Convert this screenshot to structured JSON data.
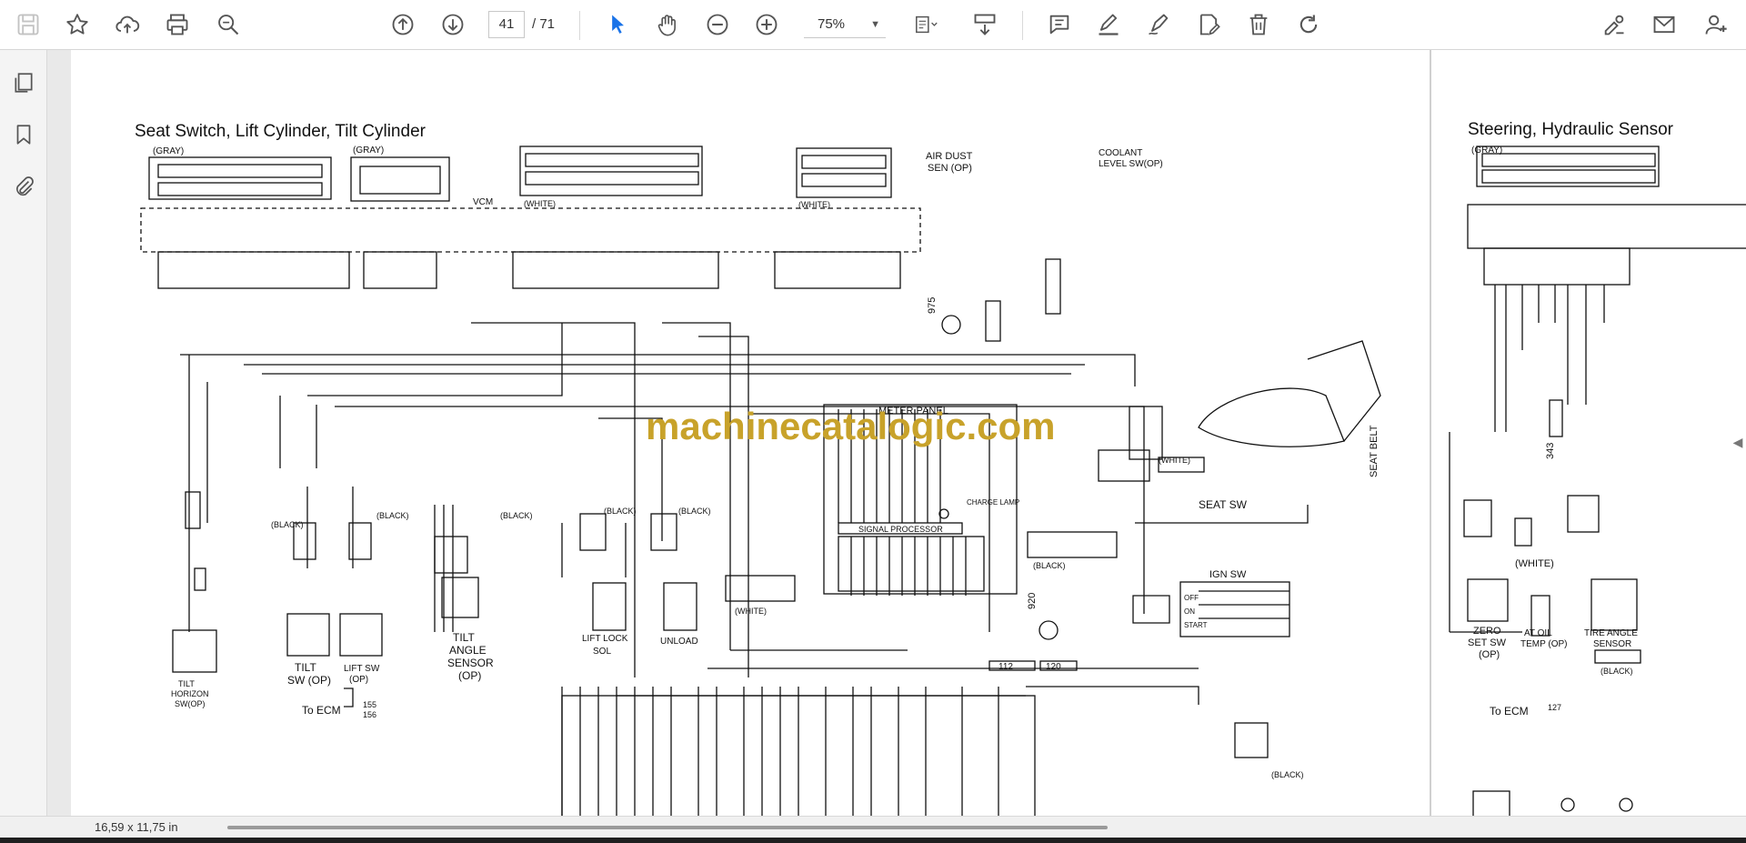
{
  "toolbar": {
    "page_current": "41",
    "page_total": "/ 71",
    "zoom": "75%",
    "colors": {
      "accent": "#1a73e8",
      "icon": "#555555"
    }
  },
  "document": {
    "watermark": "machinecatalogic.com",
    "page1": {
      "title": "Seat Switch, Lift Cylinder, Tilt Cylinder",
      "gray1": "(GRAY)",
      "gray2": "(GRAY)",
      "white1": "(WHITE)",
      "white2": "(WHITE)",
      "vcm": "VCM",
      "air_dust": "AIR DUST",
      "air_dust2": "SEN (OP)",
      "coolant": "COOLANT",
      "coolant2": "LEVEL SW(OP)",
      "meter_panel": "METER PANEL",
      "signal_processor": "SIGNAL PROCESSOR",
      "seat_sw": "SEAT SW",
      "seat_belt": "SEAT BELT",
      "ign_sw": "IGN SW",
      "ign_off": "OFF",
      "ign_on": "ON",
      "ign_start": "START",
      "tilt_horizon": "TILT",
      "tilt_horizon2": "HORIZON",
      "tilt_horizon3": "SW(OP)",
      "tilt_sw": "TILT",
      "tilt_sw2": "SW (OP)",
      "lift_sw": "LIFT SW",
      "lift_sw2": "(OP)",
      "tilt_angle": "TILT",
      "tilt_angle2": "ANGLE",
      "tilt_angle3": "SENSOR",
      "tilt_angle4": "(OP)",
      "lift_lock": "LIFT LOCK",
      "lift_lock2": "SOL",
      "unload": "UNLOAD",
      "to_ecm": "To ECM",
      "black": "(BLACK)",
      "white": "(WHITE)",
      "charge_lamp": "CHARGE LAMP",
      "c155": "155",
      "c156": "156",
      "c112": "112",
      "c120": "120",
      "c975": "975",
      "c920": "920"
    },
    "page2": {
      "title": "Steering, Hydraulic Sensor",
      "gray": "(GRAY)",
      "white": "(WHITE)",
      "zero_set": "ZERO",
      "zero_set2": "SET SW",
      "zero_set3": "(OP)",
      "at_oil": "AT OIL",
      "at_oil2": "TEMP (OP)",
      "tire_angle": "TIRE ANGLE",
      "tire_angle2": "SENSOR",
      "black": "(BLACK)",
      "to_ecm": "To ECM",
      "c127": "127",
      "c343": "343"
    }
  },
  "status": {
    "dimensions": "16,59 x 11,75 in"
  }
}
